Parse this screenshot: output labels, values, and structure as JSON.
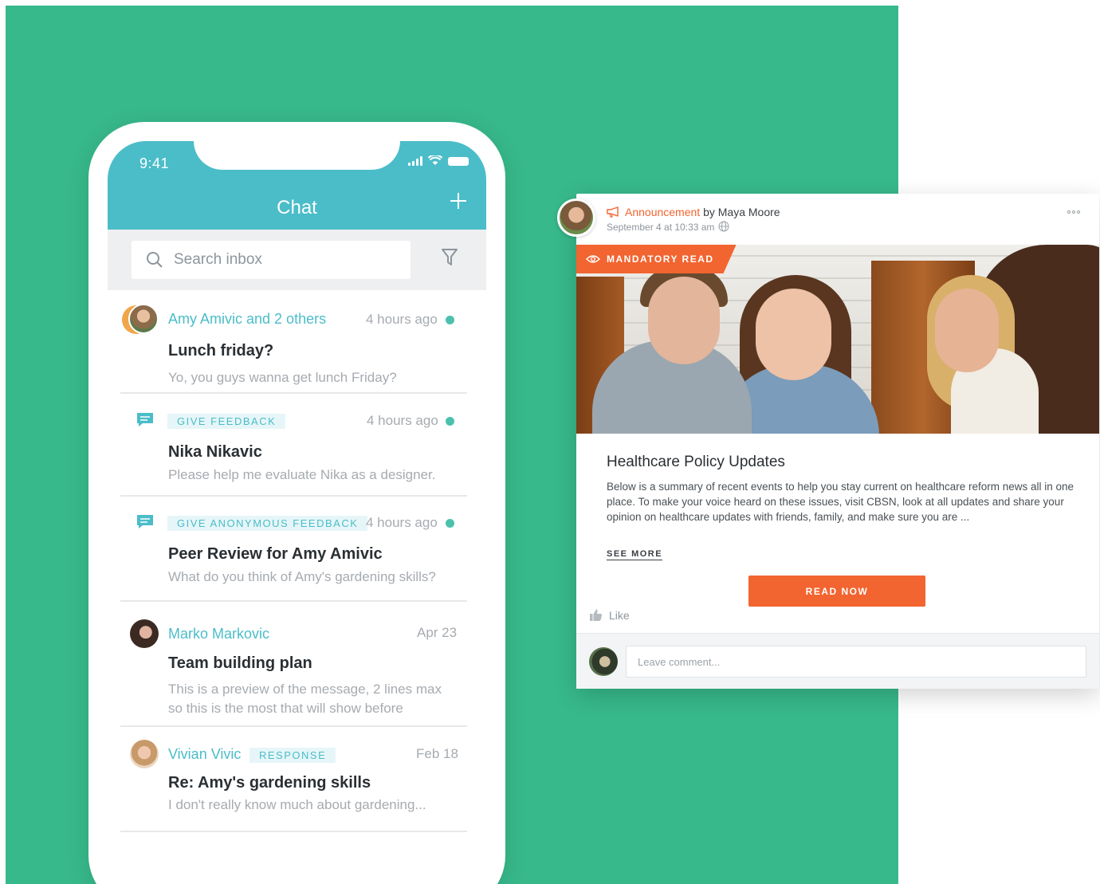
{
  "phone": {
    "status_time": "9:41",
    "header_title": "Chat",
    "search_placeholder": "Search inbox",
    "conversations": [
      {
        "name": "Amy Amivic and 2 others",
        "time": "4 hours ago",
        "unread": true,
        "title": "Lunch friday?",
        "preview": "Yo, you guys wanna get lunch Friday?"
      },
      {
        "tag": "GIVE FEEDBACK",
        "time": "4 hours ago",
        "unread": true,
        "title": "Nika Nikavic",
        "preview": "Please help me evaluate Nika as a designer."
      },
      {
        "tag": "GIVE ANONYMOUS FEEDBACK",
        "time": "4 hours ago",
        "unread": true,
        "title": "Peer Review for Amy Amivic",
        "preview": "What do you think of Amy's gardening skills?"
      },
      {
        "name": "Marko Markovic",
        "time": "Apr 23",
        "title": "Team building plan",
        "preview_line1": "This is a preview of the message, 2 lines max",
        "preview_line2": "so this is the most that will show before"
      },
      {
        "name": "Vivian Vivic",
        "tag": "RESPONSE",
        "time": "Feb 18",
        "title": "Re: Amy's gardening skills",
        "preview": "I don't really know much about gardening..."
      }
    ]
  },
  "post": {
    "type_label": "Announcement",
    "by_label": "by Maya Moore",
    "date": "September 4 at 10:33 am",
    "badge": "MANDATORY READ",
    "title": "Healthcare Policy Updates",
    "body": "Below is a summary of recent events to help you stay current on healthcare reform news all in one place. To make your voice heard on these issues, visit CBSN, look at all updates and share your opinion on healthcare updates with friends, family, and make sure you are ...",
    "see_more": "SEE MORE",
    "read_now": "READ NOW",
    "like": "Like",
    "comment_placeholder": "Leave comment..."
  },
  "colors": {
    "background_green": "#37b98b",
    "chat_header_teal": "#4bbdc9",
    "accent_orange": "#f26430",
    "unread_dot": "#4bc1ad"
  },
  "icons": [
    "search-icon",
    "filter-icon",
    "plus-icon",
    "chat-bubble-icon",
    "megaphone-icon",
    "globe-icon",
    "more-icon",
    "eye-icon",
    "thumbs-up-icon"
  ]
}
